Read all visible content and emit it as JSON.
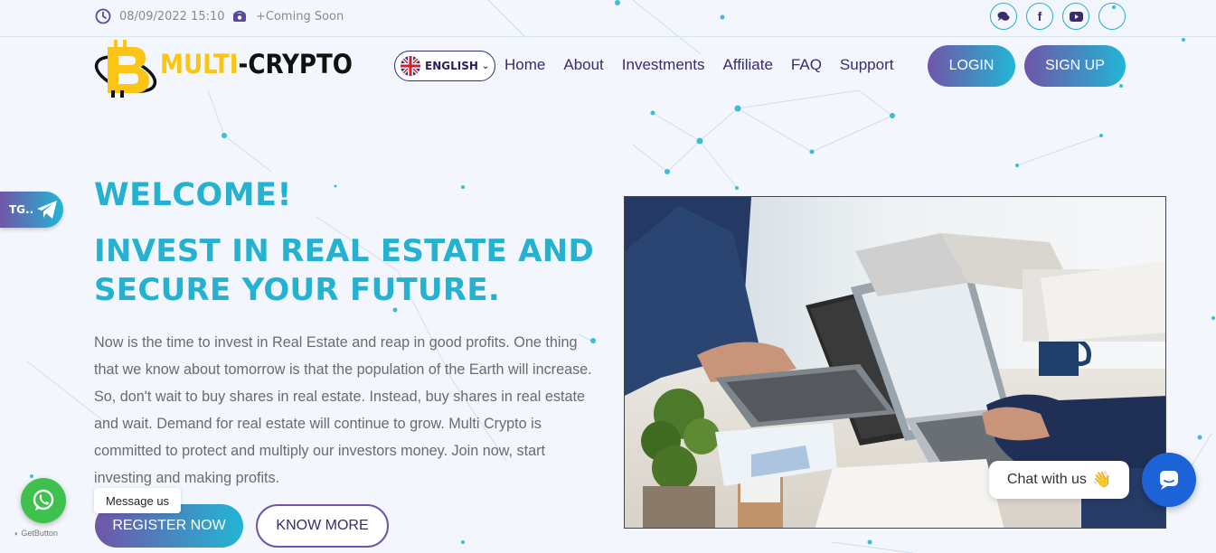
{
  "topbar": {
    "datetime": "08/09/2022 15:10",
    "phone": "+Coming Soon",
    "social_icons": [
      "chat-icon",
      "facebook-icon",
      "youtube-icon",
      "blank-icon"
    ]
  },
  "logo": {
    "multi": "MULTI",
    "crypto": "-CRYPTO"
  },
  "language": {
    "label": "ENGLISH"
  },
  "nav": {
    "items": [
      "Home",
      "About",
      "Investments",
      "Affiliate",
      "FAQ",
      "Support"
    ]
  },
  "auth": {
    "login": "LOGIN",
    "signup": "SIGN UP"
  },
  "hero": {
    "welcome": "WELCOME!",
    "headline_line1": "INVEST IN REAL ESTATE AND",
    "headline_line2": "SECURE YOUR FUTURE.",
    "paragraph": "Now is the time to invest in Real Estate and reap in good profits. One thing that we know about tomorrow is that the population of the Earth will increase. So, don't wait to buy shares in real estate. Instead, buy shares in real estate and wait. Demand for real estate will continue to grow. Multi Crypto is committed to protect and multiply our investors money. Join now, start investing and making profits.",
    "register_button": "REGISTER NOW",
    "know_more_button": "KNOW MORE"
  },
  "widgets": {
    "telegram_label": "TG..",
    "whatsapp_message": "Message us",
    "getbutton": "GetButton",
    "chat_label": "Chat with us",
    "chat_emoji": "👋"
  },
  "colors": {
    "accent_cyan": "#24b2d0",
    "accent_purple": "#7055a8",
    "logo_yellow": "#fcc514",
    "whatsapp_green": "#3fc14d",
    "chat_blue": "#1b63d6"
  }
}
